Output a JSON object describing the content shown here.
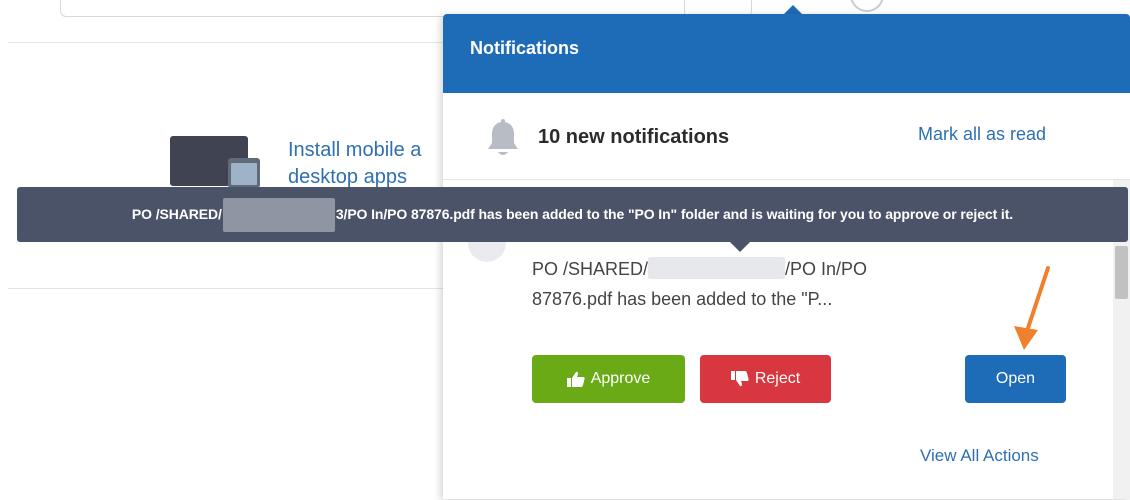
{
  "background": {
    "install_link_line1": "Install mobile a",
    "install_link_line2": "desktop apps"
  },
  "notifications": {
    "title": "Notifications",
    "summary": "10 new notifications",
    "mark_all_read": "Mark all as read",
    "item": {
      "message_part1": "PO /SHARED/",
      "message_part2": "/PO In/PO",
      "message_line2": "87876.pdf has been added to the \"P...",
      "approve_label": "Approve",
      "reject_label": "Reject",
      "open_label": "Open"
    },
    "view_all": "View All Actions"
  },
  "tooltip": {
    "text_part1": "PO /SHARED/",
    "text_part2": "3/PO In/PO 87876.pdf has been added to the \"PO In\" folder and is waiting for you to approve or reject it."
  },
  "colors": {
    "header_blue": "#1e6bb8",
    "approve_green": "#6aaa17",
    "reject_red": "#d8373f",
    "tooltip_bg": "#4a5368",
    "annotation_arrow": "#f07f2e"
  },
  "icons": {
    "bell": "bell-icon",
    "thumbs_up": "thumbs-up-icon",
    "thumbs_down": "thumbs-down-icon",
    "device": "devices-icon"
  }
}
